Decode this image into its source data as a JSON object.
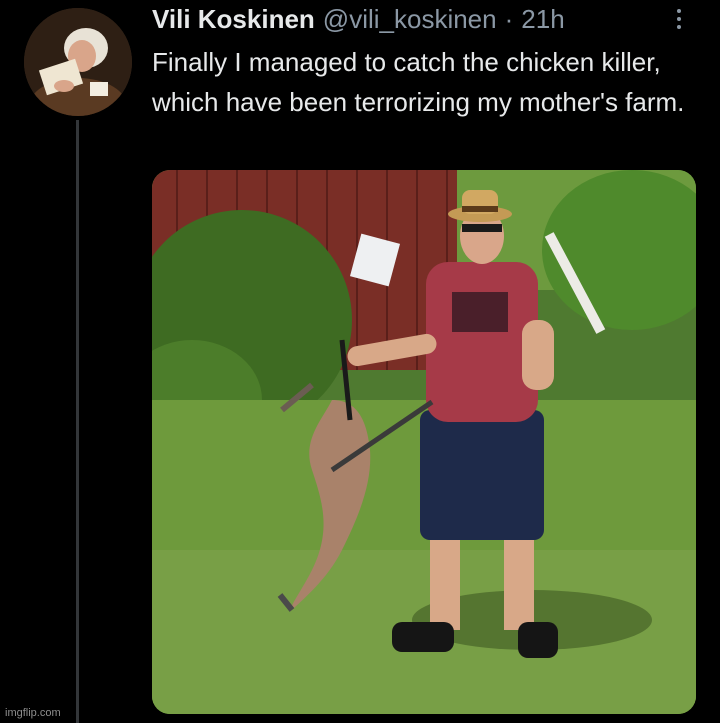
{
  "tweet": {
    "display_name": "Vili Koskinen",
    "handle": "@vili_koskinen",
    "separator": "·",
    "time": "21h",
    "text": "Finally I managed to catch the chicken killer, which have been terrorizing my mother's farm.",
    "more_icon": "more-vertical-icon"
  },
  "watermark": "imgflip.com",
  "colors": {
    "background": "#000000",
    "text_primary": "#e7e9ea",
    "text_secondary": "#8b98a5",
    "thread_line": "#333639"
  }
}
